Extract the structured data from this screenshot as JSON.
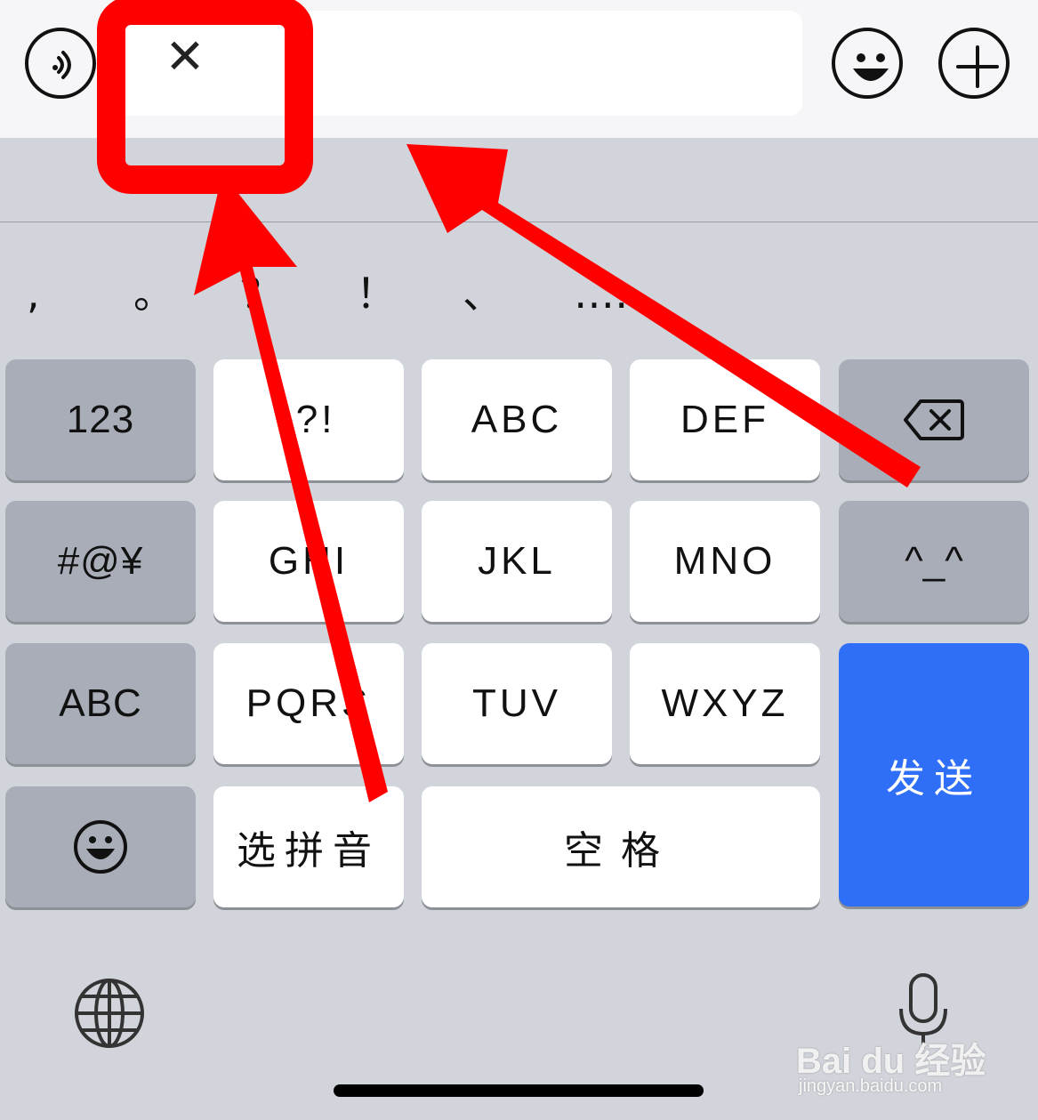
{
  "top_bar": {
    "clear_glyph": "✕",
    "voice_icon": "voice-wave-icon",
    "emoji_icon": "emoji-face-icon",
    "plus_icon": "plus-icon"
  },
  "punctuation_bar": [
    ",",
    "。",
    "？",
    "！",
    "、",
    "……"
  ],
  "keys": {
    "num": "123",
    "punct": ".?!",
    "abc1": "ABC",
    "def": "DEF",
    "sym": "#@¥",
    "ghi": "GHI",
    "jkl": "JKL",
    "mno": "MNO",
    "kaomoji": "^_^",
    "abc_switch": "ABC",
    "pqrs": "PQRS",
    "tuv": "TUV",
    "wxyz": "WXYZ",
    "send": "发送",
    "pinyin": "选拼音",
    "space": "空格"
  },
  "icons": {
    "delete": "delete-backspace-icon",
    "emoji_key": "emoji-face-icon",
    "globe": "globe-icon",
    "mic": "microphone-icon"
  },
  "colors": {
    "send_key": "#2f6ef6",
    "annotation": "#ff0000",
    "keyboard_bg": "#d1d4db"
  },
  "watermark": {
    "brand": "Bai du 经验",
    "url": "jingyan.baidu.com"
  }
}
